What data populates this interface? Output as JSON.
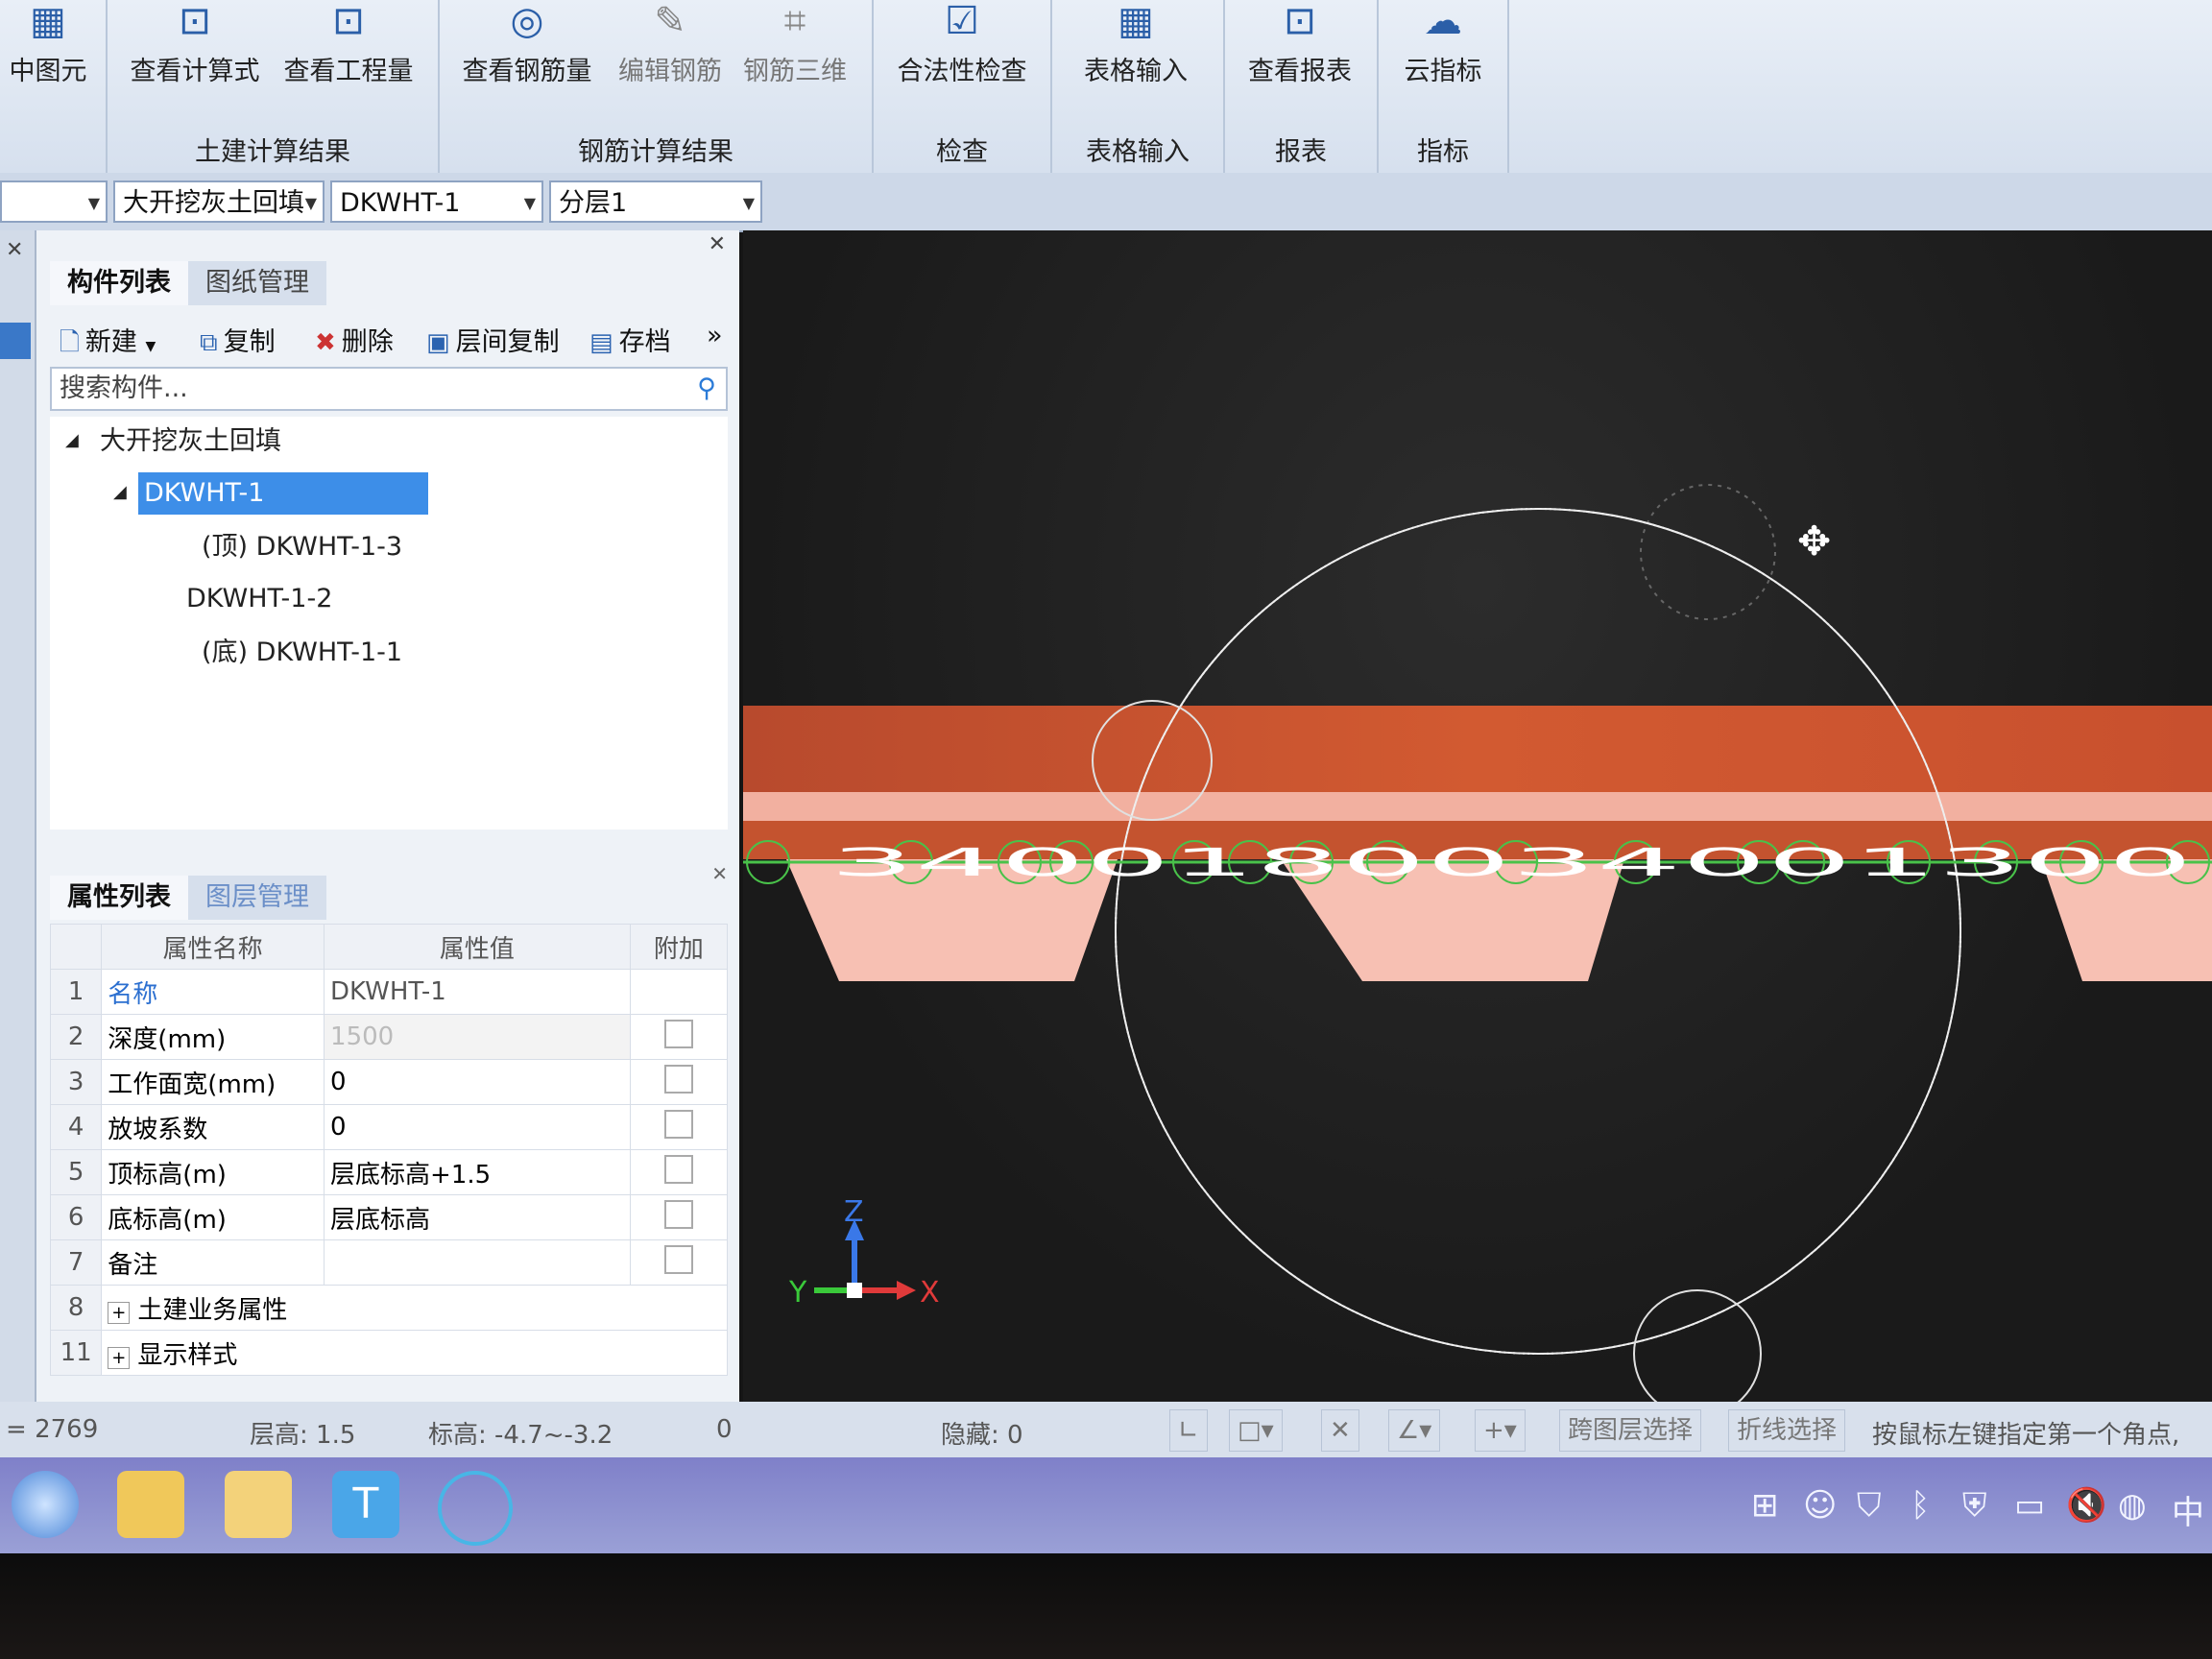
{
  "ribbon": {
    "partial_left": "中图元",
    "groups": [
      {
        "name": "土建计算结果",
        "buttons": [
          "查看计算式",
          "查看工程量"
        ]
      },
      {
        "name": "钢筋计算结果",
        "buttons": [
          "查看钢筋量",
          "编辑钢筋",
          "钢筋三维"
        ]
      },
      {
        "name": "检查",
        "buttons": [
          "合法性检查"
        ]
      },
      {
        "name": "表格输入",
        "buttons": [
          "表格输入"
        ]
      },
      {
        "name": "报表",
        "buttons": [
          "查看报表"
        ]
      },
      {
        "name": "指标",
        "buttons": [
          "云指标"
        ]
      }
    ]
  },
  "combos": {
    "type": "大开挖灰土回填",
    "element": "DKWHT-1",
    "layer": "分层1"
  },
  "panel": {
    "tabs": [
      "构件列表",
      "图纸管理"
    ],
    "toolbar": {
      "new": "新建",
      "copy": "复制",
      "delete": "删除",
      "floor_copy": "层间复制",
      "archive": "存档"
    },
    "search_placeholder": "搜索构件...",
    "tree": {
      "root": "大开挖灰土回填",
      "selected": "DKWHT-1",
      "child_top": "(顶) DKWHT-1-3",
      "child_mid": "DKWHT-1-2",
      "child_bottom": "(底) DKWHT-1-1"
    }
  },
  "properties": {
    "tabs": [
      "属性列表",
      "图层管理"
    ],
    "headers": {
      "name": "属性名称",
      "value": "属性值",
      "extra": "附加"
    },
    "rows": [
      {
        "no": "1",
        "name": "名称",
        "value": "DKWHT-1"
      },
      {
        "no": "2",
        "name": "深度(mm)",
        "value": "1500"
      },
      {
        "no": "3",
        "name": "工作面宽(mm)",
        "value": "0"
      },
      {
        "no": "4",
        "name": "放坡系数",
        "value": "0"
      },
      {
        "no": "5",
        "name": "顶标高(m)",
        "value": "层底标高+1.5"
      },
      {
        "no": "6",
        "name": "底标高(m)",
        "value": "层底标高"
      },
      {
        "no": "7",
        "name": "备注",
        "value": ""
      },
      {
        "no": "8",
        "name": "土建业务属性",
        "value": ""
      },
      {
        "no": "11",
        "name": "显示样式",
        "value": ""
      }
    ]
  },
  "viewport": {
    "dimension_text": "3400180034001300",
    "axis_labels": {
      "z": "Z",
      "y": "Y",
      "x": "X"
    }
  },
  "status": {
    "coord": "2769",
    "floor_height_label": "层高:",
    "floor_height": "1.5",
    "elevation_label": "标高:",
    "elevation": "-4.7~-3.2",
    "zero": "0",
    "hidden_label": "隐藏:",
    "hidden": "0",
    "cross_layer": "跨图层选择",
    "polyline": "折线选择",
    "hint": "按鼠标左键指定第一个角点,"
  },
  "tray_ime": "中",
  "colors": {
    "ribbon": "#dfe7f2",
    "selection": "#3d8ee8",
    "slab_top": "#c9512c",
    "slab_pink": "#f4b2a2",
    "taskbar": "#8b8fd0"
  }
}
